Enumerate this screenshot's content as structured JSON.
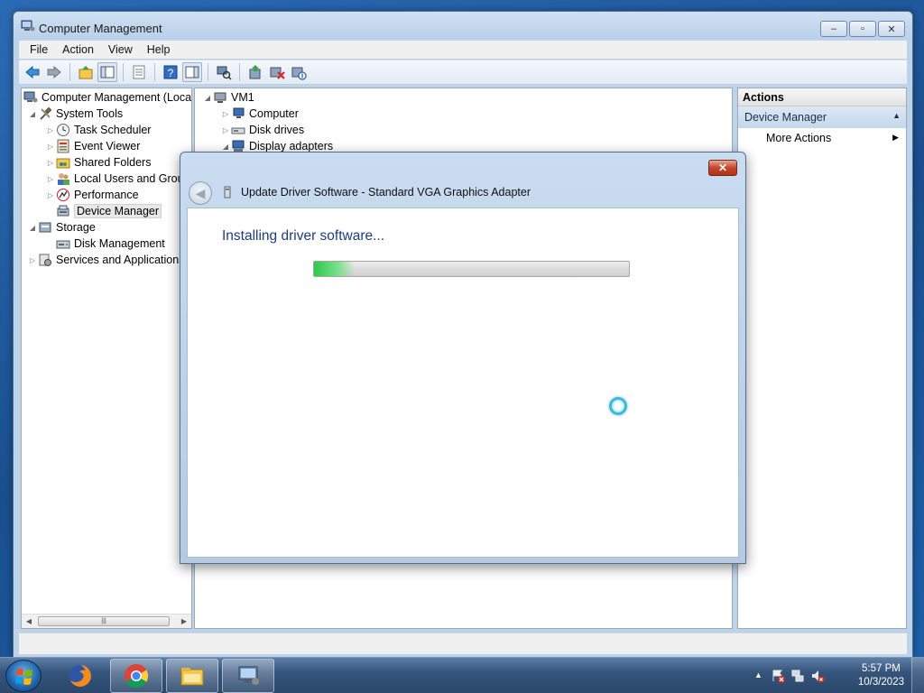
{
  "window": {
    "title": "Computer Management",
    "minimize_glyph": "‒",
    "maximize_glyph": "▫",
    "close_glyph": "✕"
  },
  "menu": [
    "File",
    "Action",
    "View",
    "Help"
  ],
  "tree": {
    "root": "Computer Management (Local",
    "system_tools": "System Tools",
    "task_scheduler": "Task Scheduler",
    "event_viewer": "Event Viewer",
    "shared_folders": "Shared Folders",
    "local_users": "Local Users and Group",
    "performance": "Performance",
    "device_manager": "Device Manager",
    "storage": "Storage",
    "disk_management": "Disk Management",
    "services": "Services and Applications"
  },
  "device_tree": {
    "root": "VM1",
    "items": [
      "Computer",
      "Disk drives",
      "Display adapters"
    ]
  },
  "actions": {
    "header": "Actions",
    "section": "Device Manager",
    "more_actions": "More Actions"
  },
  "dialog": {
    "title": "Update Driver Software - Standard VGA Graphics Adapter",
    "close_glyph": "✕",
    "heading": "Installing driver software...",
    "progress_fraction": 0.13
  },
  "taskbar": {
    "time": "5:57 PM",
    "date": "10/3/2023",
    "apps": [
      "firefox-icon",
      "chrome-icon",
      "explorer-icon",
      "computer-management-icon"
    ]
  },
  "colors": {
    "progress_green": "#2dc94b",
    "heading_blue": "#1e3b7a",
    "close_red": "#c4452c"
  }
}
